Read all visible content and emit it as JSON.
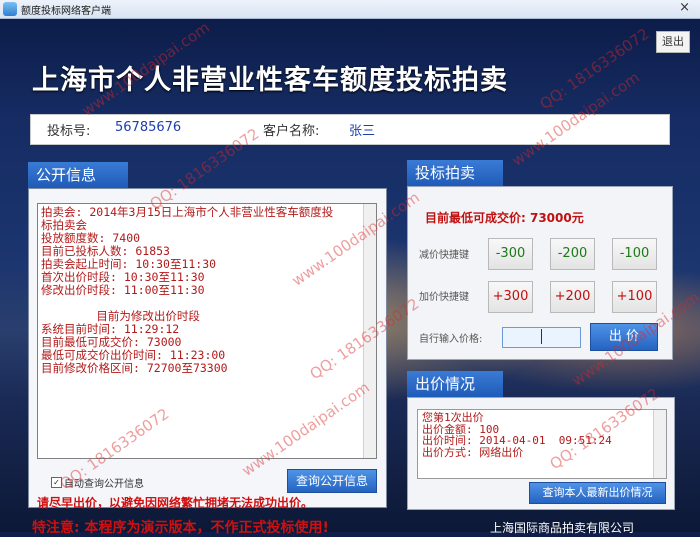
{
  "window": {
    "title": "额度投标网络客户端",
    "close_glyph": "×"
  },
  "header": {
    "logout_label": "退出",
    "main_title": "上海市个人非营业性客车额度投标拍卖"
  },
  "user_info": {
    "bid_no_label": "投标号:",
    "bid_no": "56785676",
    "name_label": "客户名称:",
    "name": "张三"
  },
  "public_info": {
    "heading": "公开信息",
    "notice_text": "拍卖会: 2014年3月15日上海市个人非营业性客车额度投\n标拍卖会\n投放额度数: 7400\n目前已投标人数: 61853\n拍卖会起止时间: 10:30至11:30\n首次出价时段: 10:30至11:30\n修改出价时段: 11:00至11:30\n\n        目前为修改出价时段\n系统目前时间: 11:29:12\n目前最低可成交价: 73000\n最低可成交价出价时间: 11:23:00\n目前修改价格区间: 72700至73300",
    "auto_query_label": "自动查询公开信息",
    "auto_query_checked": true,
    "query_button": "查询公开信息",
    "warning": "请尽早出价，以避免因网络繁忙拥堵无法成功出价。"
  },
  "bidding": {
    "heading": "投标拍卖",
    "lowest_price_text": "目前最低可成交价: 73000元",
    "decrease_label": "减价快捷键",
    "increase_label": "加价快捷键",
    "decrease_buttons": [
      "-300",
      "-200",
      "-100"
    ],
    "increase_buttons": [
      "+300",
      "+200",
      "+100"
    ],
    "input_label": "自行输入价格:",
    "price_value": "",
    "bid_button": "出  价"
  },
  "bid_status": {
    "heading": "出价情况",
    "text": "您第1次出价\n出价金额: 100\n出价时间: 2014-04-01  09:51:24\n出价方式: 网络出价",
    "query_button": "查询本人最新出价情况"
  },
  "footer": {
    "red_text": "特注意: 本程序为演示版本，不作正式投标使用!",
    "blue_text": "上海国际商品拍卖有限公司"
  },
  "watermarks": {
    "site": "www.100daipai.com",
    "qq": "QQ: 1816336072"
  },
  "colors": {
    "accent_blue": "#2a6bcb",
    "alert_red": "#c01010",
    "bg_dark": "#0f1f4a"
  }
}
